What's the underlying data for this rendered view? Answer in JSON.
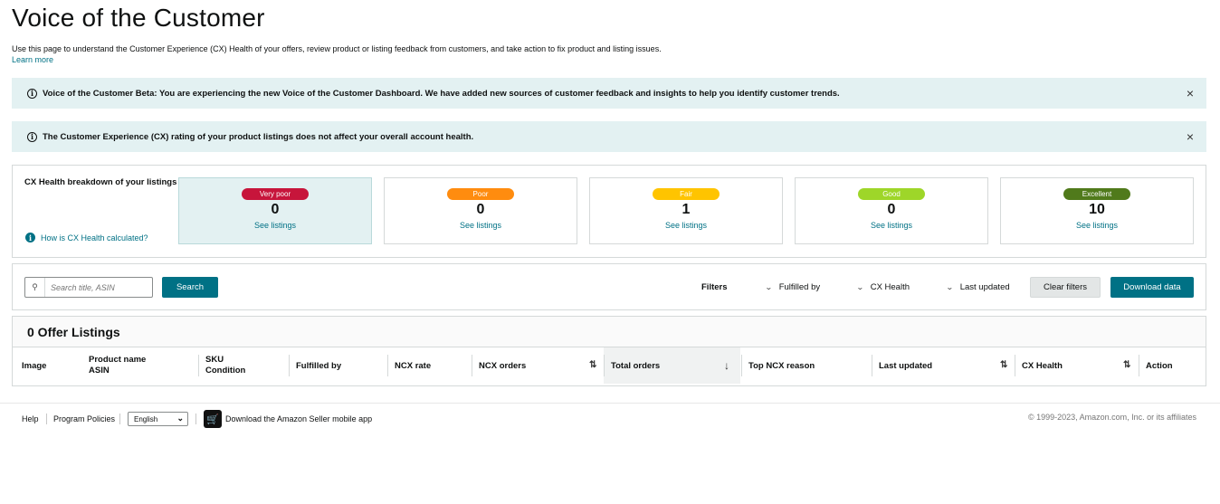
{
  "header": {
    "title": "Voice of the Customer",
    "description": "Use this page to understand the Customer Experience (CX) Health of your offers, review product or listing feedback from customers, and take action to fix product and listing issues.",
    "learn_more": "Learn more"
  },
  "alerts": [
    {
      "icon": "info-icon",
      "text": "Voice of the Customer Beta: You are experiencing the new Voice of the Customer Dashboard. We have added new sources of customer feedback and insights to help you identify customer trends.",
      "close": "×"
    },
    {
      "icon": "info-icon",
      "text": "The Customer Experience (CX) rating of your product listings does not affect your overall account health.",
      "close": "×"
    }
  ],
  "cx_breakdown": {
    "label": "CX Health breakdown of your listings",
    "help_link": "How is CX Health calculated?",
    "cards": [
      {
        "rating": "Very poor",
        "count": "0",
        "link": "See listings",
        "color": "#c7153b",
        "selected": true
      },
      {
        "rating": "Poor",
        "count": "0",
        "link": "See listings",
        "color": "#ff8c0f",
        "selected": false
      },
      {
        "rating": "Fair",
        "count": "1",
        "link": "See listings",
        "color": "#ffc400",
        "selected": false
      },
      {
        "rating": "Good",
        "count": "0",
        "link": "See listings",
        "color": "#9ed629",
        "selected": false
      },
      {
        "rating": "Excellent",
        "count": "10",
        "link": "See listings",
        "color": "#507a1b",
        "selected": false
      }
    ]
  },
  "toolbar": {
    "search_placeholder": "Search title, ASIN",
    "search_button": "Search",
    "filters_label": "Filters",
    "filters": [
      "Fulfilled by",
      "CX Health",
      "Last updated"
    ],
    "clear_filters": "Clear filters",
    "download": "Download data"
  },
  "listings": {
    "heading": "0 Offer Listings",
    "columns": [
      {
        "line1": "Image",
        "line2": ""
      },
      {
        "line1": "Product name",
        "line2": "ASIN"
      },
      {
        "line1": "SKU",
        "line2": "Condition"
      },
      {
        "line1": "Fulfilled by",
        "line2": ""
      },
      {
        "line1": "NCX rate",
        "line2": ""
      },
      {
        "line1": "NCX orders",
        "line2": ""
      },
      {
        "line1": "Total orders",
        "line2": ""
      },
      {
        "line1": "Top NCX reason",
        "line2": ""
      },
      {
        "line1": "Last updated",
        "line2": ""
      },
      {
        "line1": "CX Health",
        "line2": ""
      },
      {
        "line1": "Action",
        "line2": ""
      }
    ]
  },
  "footer": {
    "help": "Help",
    "policies": "Program Policies",
    "language": "English",
    "app_text": "Download the Amazon Seller mobile app",
    "copyright": "© 1999-2023, Amazon.com, Inc. or its affiliates"
  },
  "colors": {
    "teal": "#007185",
    "alert_bg": "#e3f1f2"
  }
}
